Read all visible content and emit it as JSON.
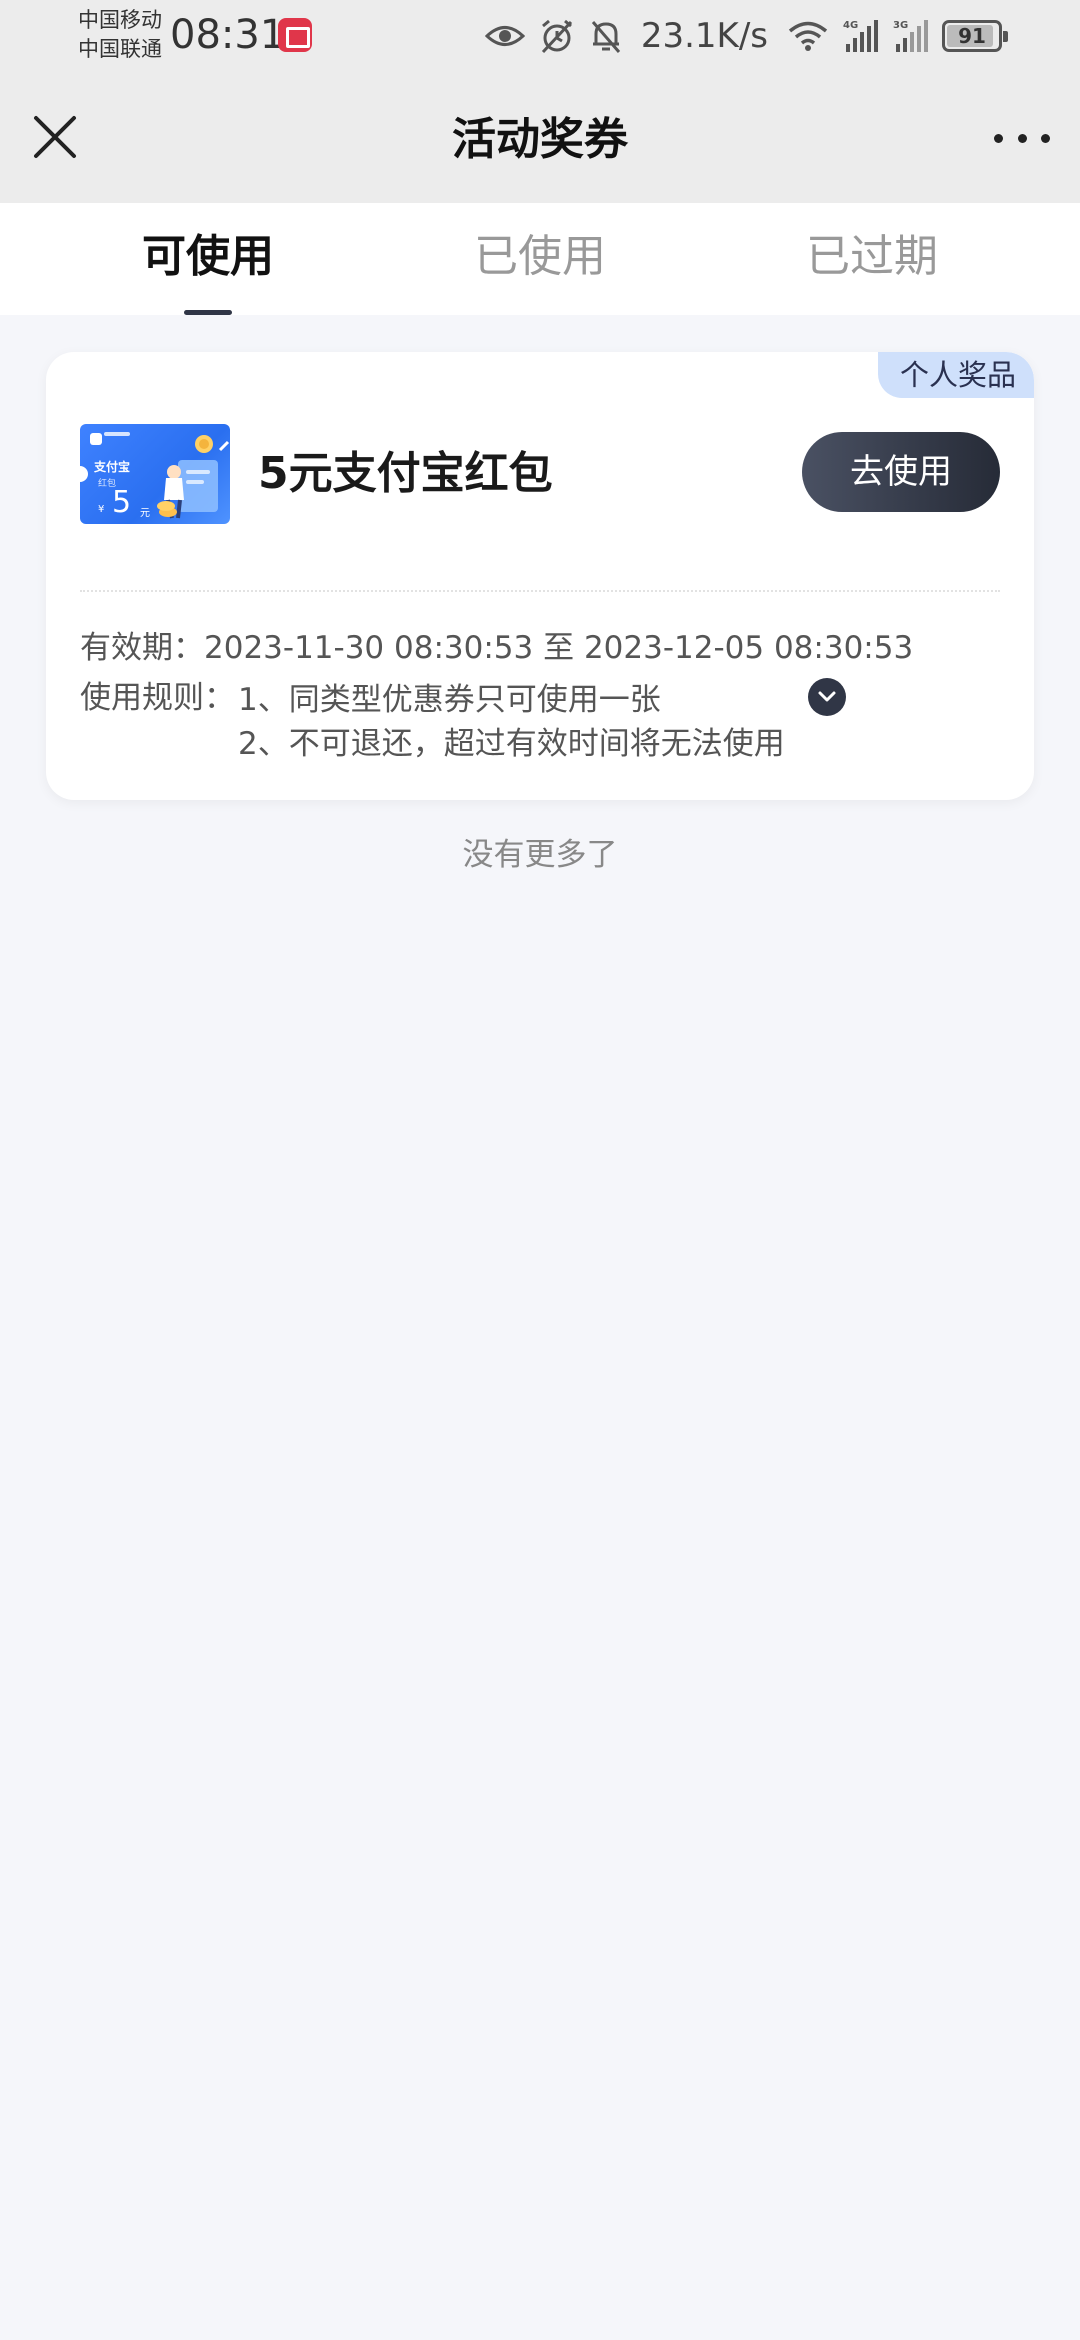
{
  "status_bar": {
    "carrier_1": "中国移动",
    "carrier_2": "中国联通",
    "time": "08:31",
    "net_speed": "23.1K/s",
    "net_1": "4G",
    "net_2": "3G",
    "battery": "91"
  },
  "nav": {
    "title": "活动奖券"
  },
  "tabs": [
    {
      "label": "可使用",
      "active": true
    },
    {
      "label": "已使用",
      "active": false
    },
    {
      "label": "已过期",
      "active": false
    }
  ],
  "coupon": {
    "tag": "个人奖品",
    "thumb_name": "支付宝",
    "thumb_sub": "红包",
    "thumb_yen": "¥",
    "thumb_amount": "5",
    "thumb_unit": "元",
    "title": "5元支付宝红包",
    "button_label": "去使用",
    "validity": "有效期：2023-11-30 08:30:53 至 2023-12-05 08:30:53",
    "rules_label": "使用规则：",
    "rules": [
      "1、同类型优惠券只可使用一张",
      "2、不可退还，超过有效时间将无法使用"
    ]
  },
  "footer": {
    "no_more": "没有更多了"
  }
}
